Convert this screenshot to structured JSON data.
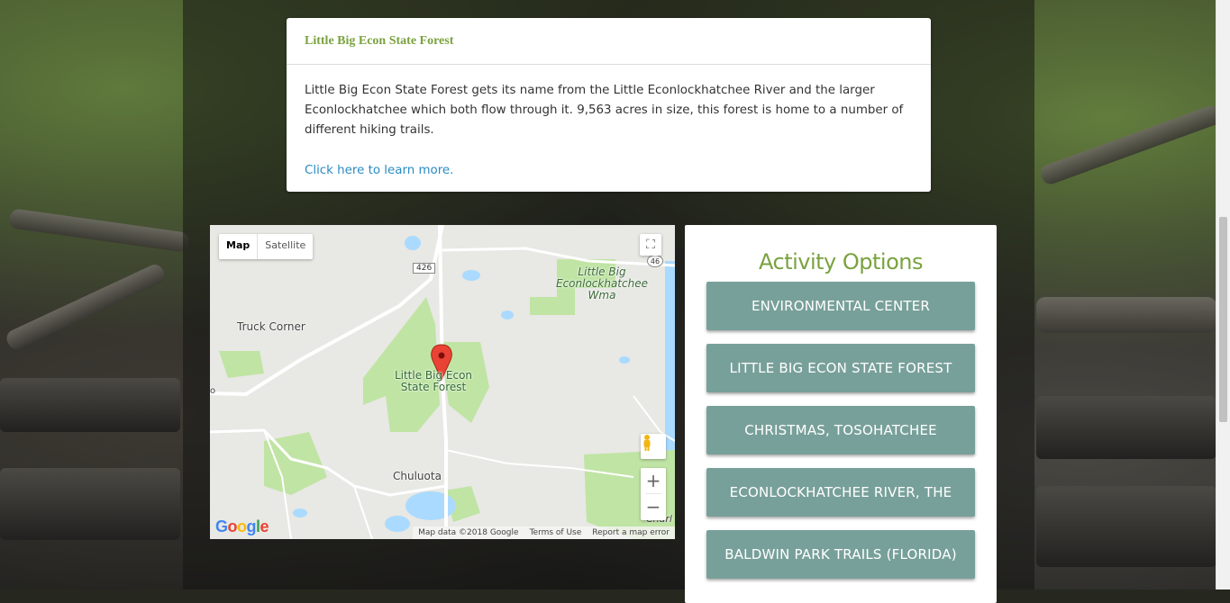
{
  "info_card": {
    "title": "Little Big Econ State Forest",
    "description": "Little Big Econ State Forest gets its name from the Little Econlockhatchee River and the larger Econlockhatchee which both flow through it. 9,563 acres in size, this forest is home to a number of different hiking trails.",
    "link_text": "Click here to learn more."
  },
  "map": {
    "type_active": "Map",
    "type_inactive": "Satellite",
    "labels": {
      "truck_corner": "Truck Corner",
      "wma": "Little Big Econlockhatchee Wma",
      "forest": "Little Big Econ State Forest",
      "chuluota": "Chuluota",
      "charl": "Charl",
      "route_426": "426",
      "route_46": "46",
      "o": "o"
    },
    "logo": "Google",
    "footer": {
      "data": "Map data ©2018 Google",
      "terms": "Terms of Use",
      "report": "Report a map error"
    }
  },
  "activity": {
    "heading": "Activity Options",
    "options": [
      "ENVIRONMENTAL CENTER",
      "LITTLE BIG ECON STATE FOREST",
      "CHRISTMAS, TOSOHATCHEE",
      "ECONLOCKHATCHEE RIVER, THE",
      "BALDWIN PARK TRAILS (FLORIDA)"
    ],
    "button_color": "#78a09a",
    "heading_color": "#7aa23f"
  }
}
